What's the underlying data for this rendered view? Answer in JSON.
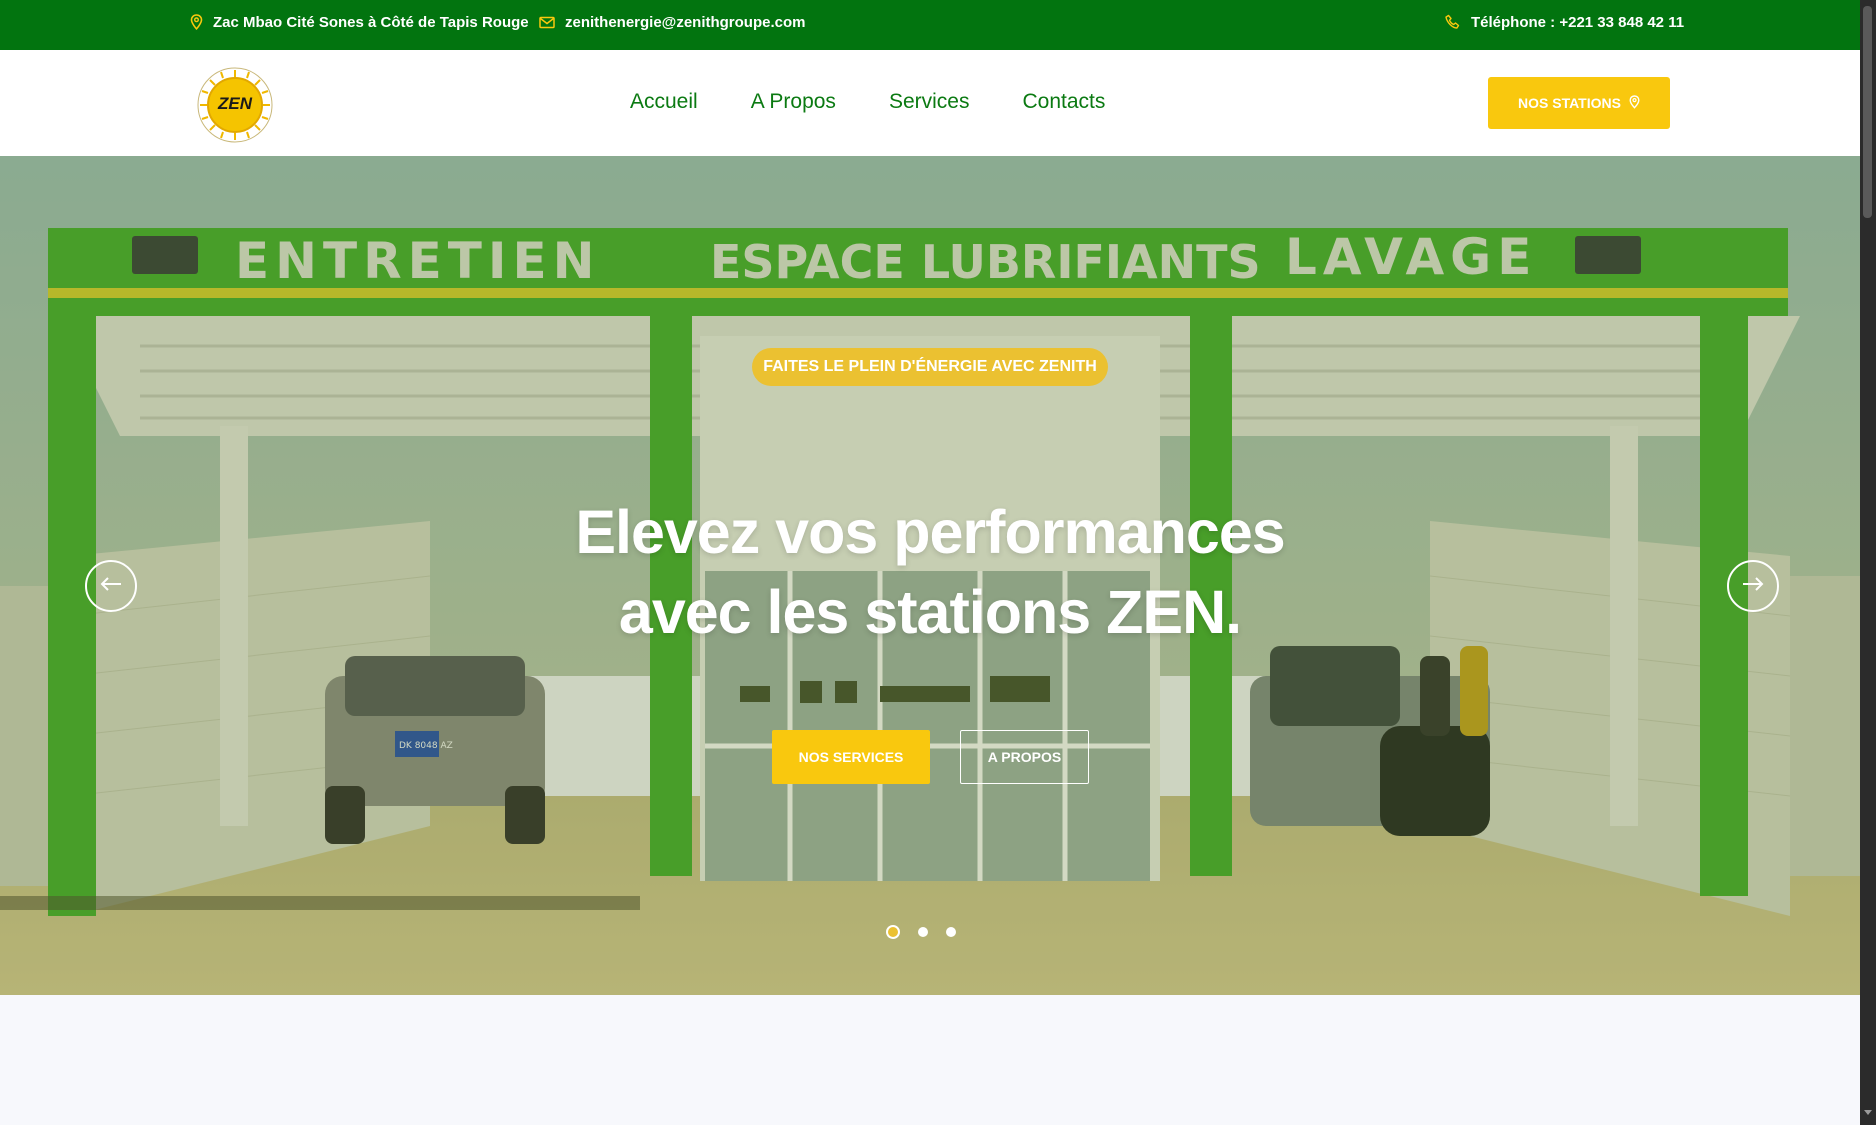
{
  "topbar": {
    "address": "Zac Mbao Cité Sones à Côté de Tapis Rouge",
    "email": "zenithenergie@zenithgroupe.com",
    "phone": "Téléphone : +221 33 848 42 11",
    "icons": [
      "map-pin-icon",
      "mail-icon",
      "phone-icon"
    ]
  },
  "header": {
    "logo_text": "ZEN",
    "nav": [
      "Accueil",
      "A Propos",
      "Services",
      "Contacts"
    ],
    "cta_label": "NOS STATIONS"
  },
  "hero": {
    "tagline": "FAITES LE PLEIN D'ÉNERGIE AVEC ZENITH",
    "headline_line1": "Elevez vos performances",
    "headline_line2": "avec les stations ZEN.",
    "btn_services": "NOS SERVICES",
    "btn_about": "A PROPOS",
    "slide_count": 3,
    "active_slide": 1,
    "sign_texts": [
      "ENTRETIEN",
      "ESPACE LUBRIFIANTS",
      "LAVAGE"
    ],
    "plate_text": "DK 8048 AZ"
  },
  "colors": {
    "topbar_bg": "#02740f",
    "accent_yellow": "#f9c80e",
    "nav_green": "#0b7a12",
    "canopy_green": "#3fae2a"
  }
}
